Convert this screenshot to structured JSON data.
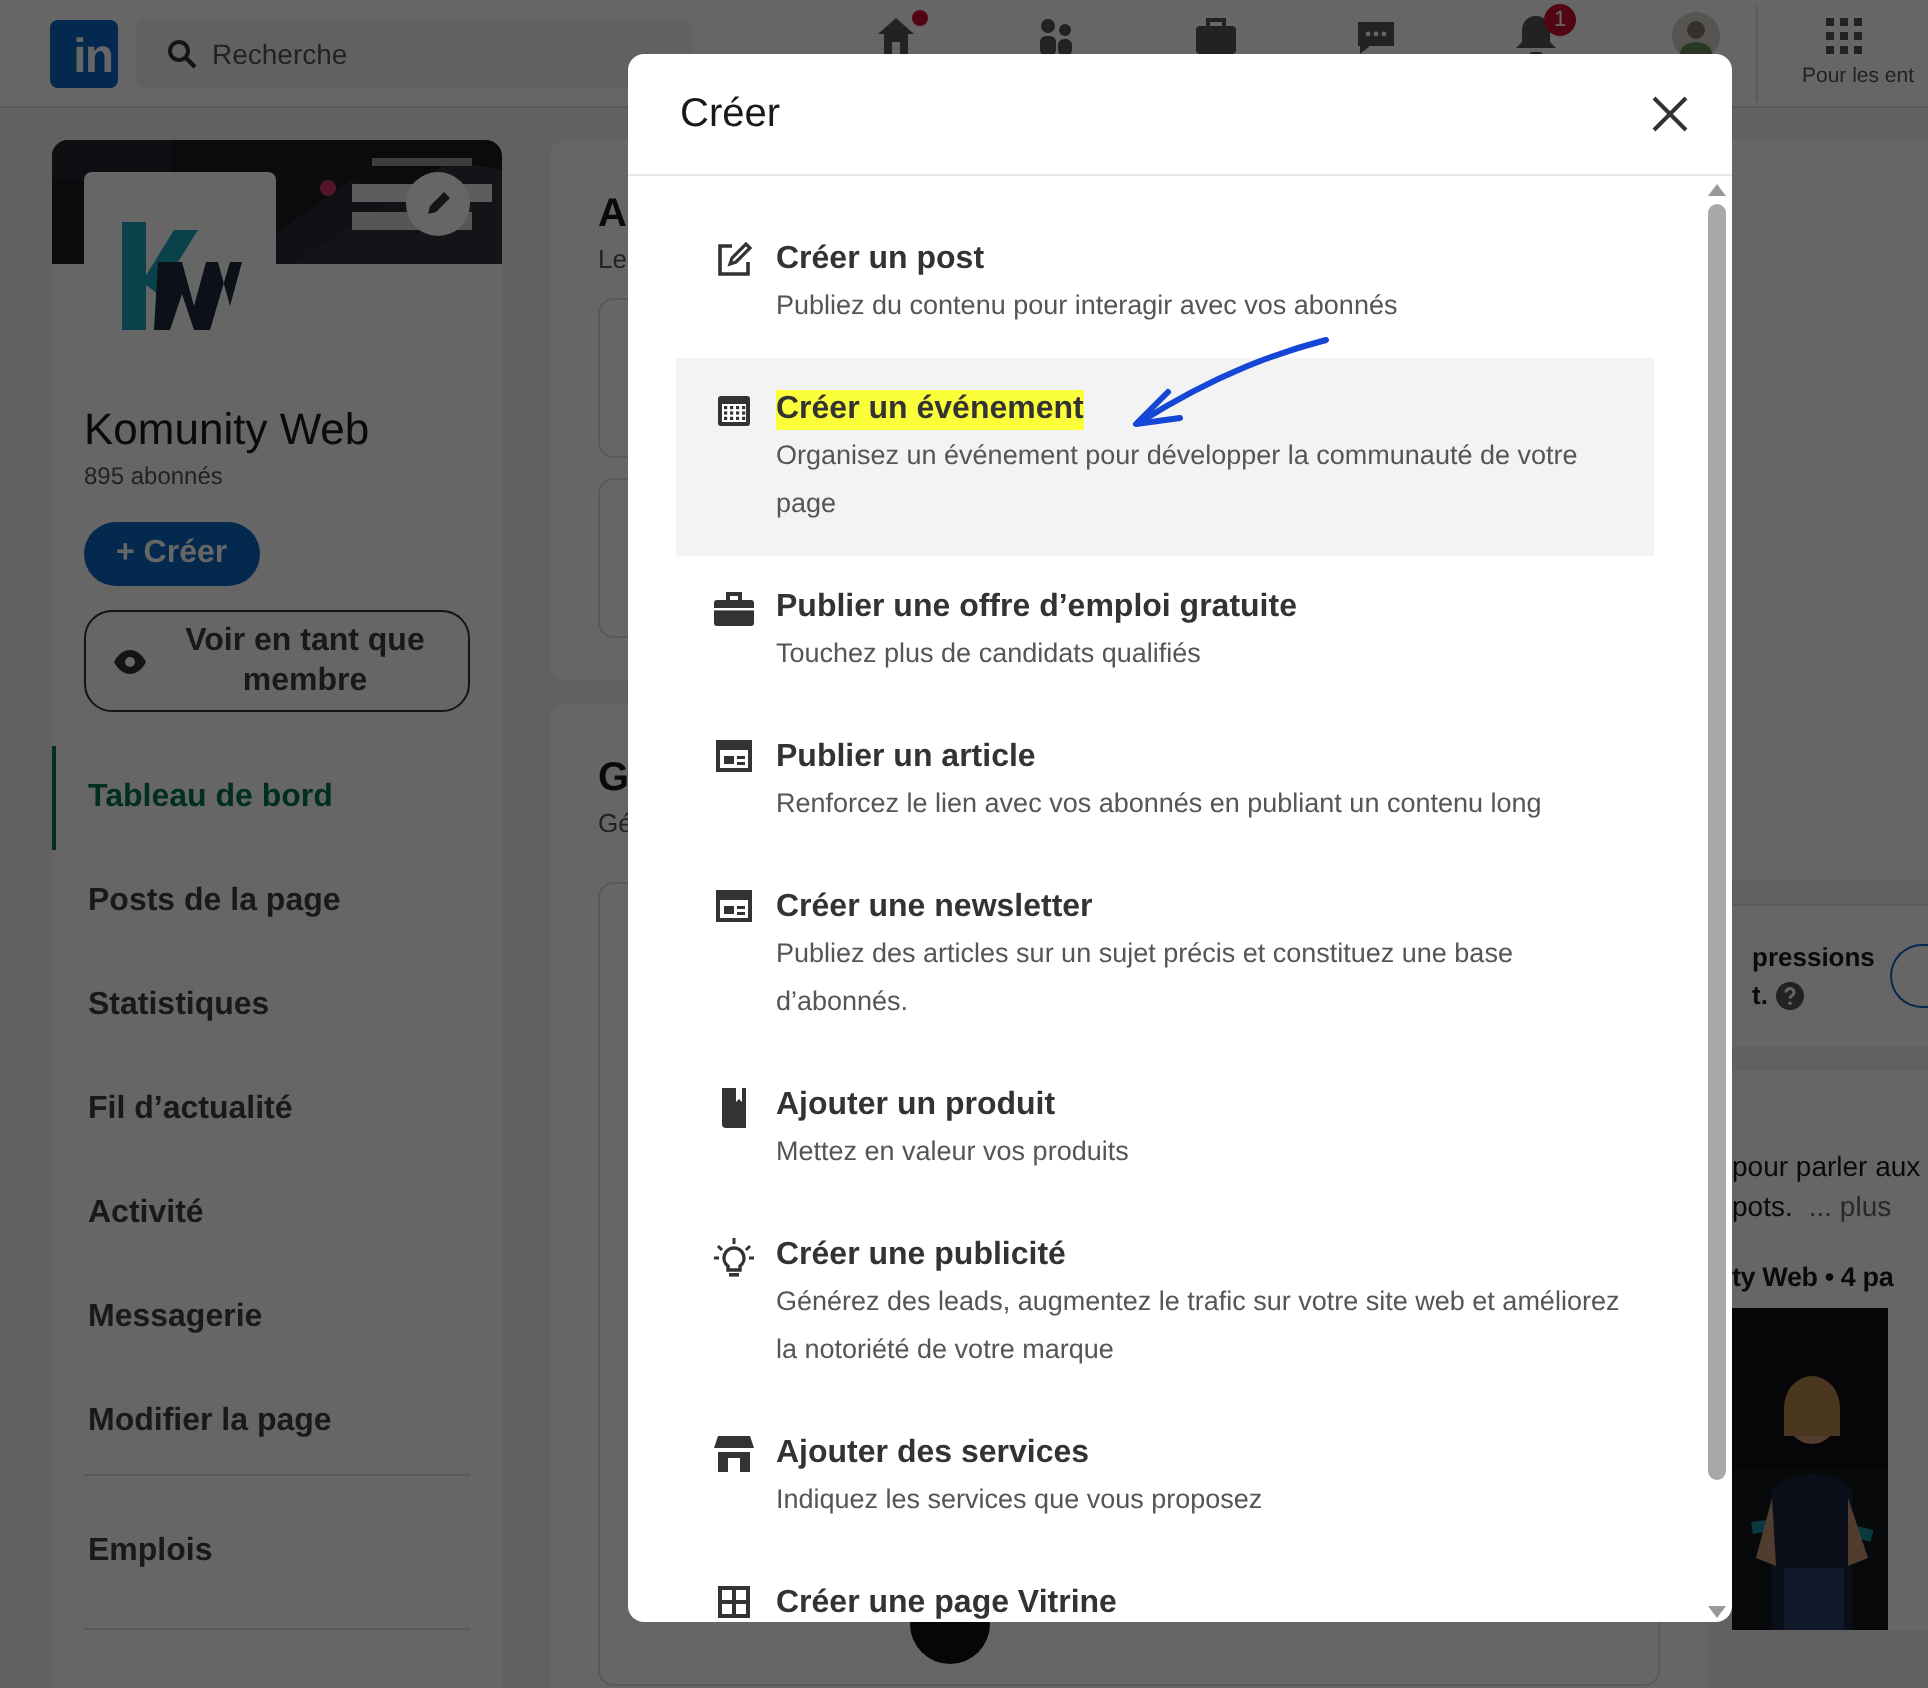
{
  "top_nav": {
    "logo": "in",
    "search": {
      "placeholder": "Recherche"
    },
    "nav_items": [
      {
        "notification_dot": true
      },
      {
        "notification_dot": false
      },
      {
        "notification_dot": false
      },
      {
        "notification_dot": false
      },
      {
        "notification_dot": false,
        "badge": "1"
      },
      {
        "notification_dot": false
      }
    ],
    "business_menu": "Pour les ent"
  },
  "sidebar": {
    "page_name": "Komunity Web",
    "followers": "895 abonnés",
    "create_button": "+ Créer",
    "view_as_button": "Voir en tant que membre",
    "nav_items": [
      {
        "label": "Tableau de bord",
        "selected": true
      },
      {
        "label": "Posts de la page",
        "selected": false
      },
      {
        "label": "Statistiques",
        "selected": false
      },
      {
        "label": "Fil d’actualité",
        "selected": false
      },
      {
        "label": "Activité",
        "selected": false
      },
      {
        "label": "Messagerie",
        "selected": false
      },
      {
        "label": "Modifier la page",
        "selected": false
      }
    ],
    "secondary_items": [
      {
        "label": "Emplois"
      }
    ]
  },
  "main_cards": [
    {
      "title": "A",
      "subtitle": "Le"
    },
    {
      "title": "G",
      "subtitle": "Gé"
    }
  ],
  "right_column": {
    "impressions_title": "pressions",
    "impressions_sub": "t.",
    "post_lines": [
      "pour parler aux",
      "pots."
    ],
    "more_link": "... plus",
    "post_author": "ty Web • 4 pa"
  },
  "dialog": {
    "title": "Créer",
    "items": [
      {
        "title": "Créer un post",
        "description": "Publiez du contenu pour interagir avec vos abonnés",
        "selected": false,
        "highlighted": false
      },
      {
        "title": "Créer un événement",
        "description": "Organisez un événement pour développer la communauté de votre page",
        "selected": true,
        "highlighted": true
      },
      {
        "title": "Publier une offre d’emploi gratuite",
        "description": "Touchez plus de candidats qualifiés",
        "selected": false,
        "highlighted": false
      },
      {
        "title": "Publier un article",
        "description": "Renforcez le lien avec vos abonnés en publiant un contenu long",
        "selected": false,
        "highlighted": false
      },
      {
        "title": "Créer une newsletter",
        "description": "Publiez des articles sur un sujet précis et constituez une base d’abonnés.",
        "selected": false,
        "highlighted": false
      },
      {
        "title": "Ajouter un produit",
        "description": "Mettez en valeur vos produits",
        "selected": false,
        "highlighted": false
      },
      {
        "title": "Créer une publicité",
        "description": "Générez des leads, augmentez le trafic sur votre site web et améliorez la notoriété de votre marque",
        "selected": false,
        "highlighted": false
      },
      {
        "title": "Ajouter des services",
        "description": "Indiquez les services que vous proposez",
        "selected": false,
        "highlighted": false
      },
      {
        "title": "Créer une page Vitrine",
        "selected": false,
        "highlighted": false
      }
    ]
  }
}
